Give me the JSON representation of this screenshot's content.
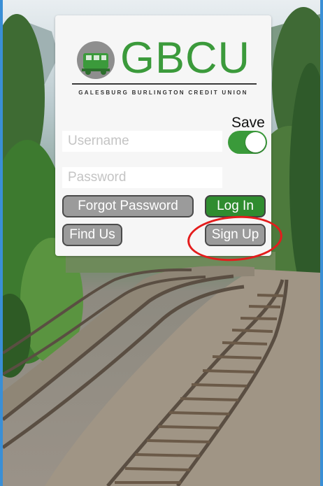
{
  "brand": {
    "wordmark": "GBCU",
    "tagline": "GALESBURG BURLINGTON CREDIT UNION",
    "color": "#3b9a3b"
  },
  "login": {
    "save_label": "Save",
    "save_toggle_on": true,
    "username_placeholder": "Username",
    "password_placeholder": "Password",
    "forgot_password_label": "Forgot Password",
    "login_label": "Log In",
    "find_us_label": "Find Us",
    "sign_up_label": "Sign Up"
  },
  "annotation": {
    "highlight_color": "#e41c1c",
    "highlighted": "sign-up-button"
  },
  "colors": {
    "accent_green": "#2f8c2f",
    "button_gray": "#9b9b9b",
    "frame_blue": "#3a8fd6"
  },
  "icons": [
    "train-logo-icon"
  ]
}
